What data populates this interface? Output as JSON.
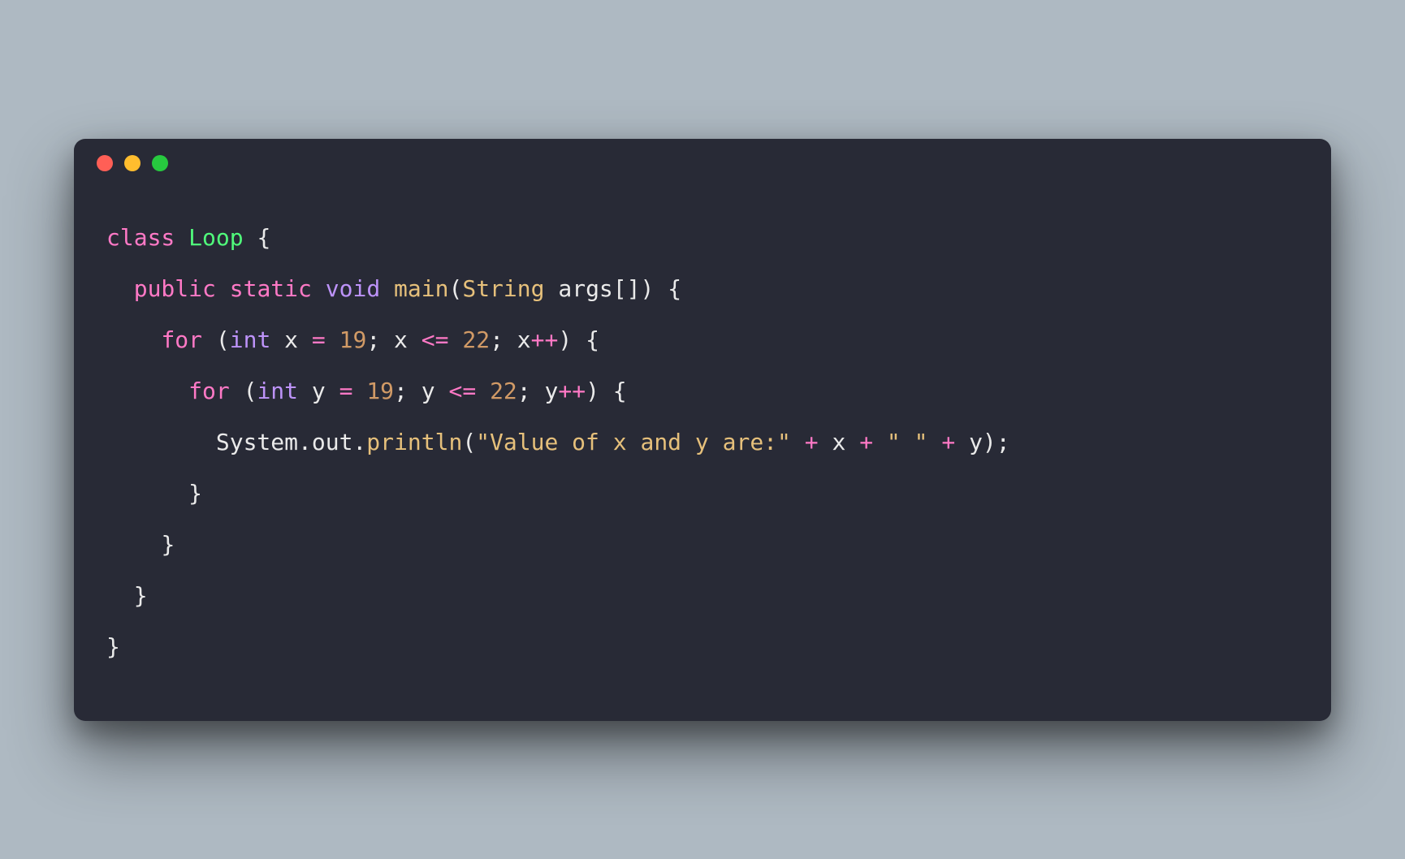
{
  "window": {
    "buttons": [
      "close",
      "minimize",
      "zoom"
    ]
  },
  "code": {
    "language": "java",
    "lines": [
      {
        "indent": 0,
        "tokens": [
          {
            "t": "class ",
            "c": "kw"
          },
          {
            "t": "Loop",
            "c": "class"
          },
          {
            "t": " {",
            "c": "plain"
          }
        ]
      },
      {
        "indent": 1,
        "tokens": [
          {
            "t": "public ",
            "c": "kw"
          },
          {
            "t": "static ",
            "c": "kw"
          },
          {
            "t": "void ",
            "c": "type"
          },
          {
            "t": "main",
            "c": "fn"
          },
          {
            "t": "(",
            "c": "plain"
          },
          {
            "t": "String",
            "c": "str"
          },
          {
            "t": " args[]) {",
            "c": "plain"
          }
        ]
      },
      {
        "indent": 2,
        "tokens": [
          {
            "t": "for ",
            "c": "kw"
          },
          {
            "t": "(",
            "c": "plain"
          },
          {
            "t": "int",
            "c": "type"
          },
          {
            "t": " x ",
            "c": "plain"
          },
          {
            "t": "=",
            "c": "op"
          },
          {
            "t": " ",
            "c": "plain"
          },
          {
            "t": "19",
            "c": "num"
          },
          {
            "t": "; x ",
            "c": "plain"
          },
          {
            "t": "<=",
            "c": "op"
          },
          {
            "t": " ",
            "c": "plain"
          },
          {
            "t": "22",
            "c": "num"
          },
          {
            "t": "; x",
            "c": "plain"
          },
          {
            "t": "++",
            "c": "op"
          },
          {
            "t": ") {",
            "c": "plain"
          }
        ]
      },
      {
        "indent": 3,
        "tokens": [
          {
            "t": "for ",
            "c": "kw"
          },
          {
            "t": "(",
            "c": "plain"
          },
          {
            "t": "int",
            "c": "type"
          },
          {
            "t": " y ",
            "c": "plain"
          },
          {
            "t": "=",
            "c": "op"
          },
          {
            "t": " ",
            "c": "plain"
          },
          {
            "t": "19",
            "c": "num"
          },
          {
            "t": "; y ",
            "c": "plain"
          },
          {
            "t": "<=",
            "c": "op"
          },
          {
            "t": " ",
            "c": "plain"
          },
          {
            "t": "22",
            "c": "num"
          },
          {
            "t": "; y",
            "c": "plain"
          },
          {
            "t": "++",
            "c": "op"
          },
          {
            "t": ") {",
            "c": "plain"
          }
        ]
      },
      {
        "indent": 4,
        "tokens": [
          {
            "t": "System.out.",
            "c": "plain"
          },
          {
            "t": "println",
            "c": "fn"
          },
          {
            "t": "(",
            "c": "plain"
          },
          {
            "t": "\"Value of x and y are:\"",
            "c": "lit"
          },
          {
            "t": " ",
            "c": "plain"
          },
          {
            "t": "+",
            "c": "op"
          },
          {
            "t": " x ",
            "c": "plain"
          },
          {
            "t": "+",
            "c": "op"
          },
          {
            "t": " ",
            "c": "plain"
          },
          {
            "t": "\" \"",
            "c": "lit"
          },
          {
            "t": " ",
            "c": "plain"
          },
          {
            "t": "+",
            "c": "op"
          },
          {
            "t": " y);",
            "c": "plain"
          }
        ]
      },
      {
        "indent": 3,
        "tokens": [
          {
            "t": "}",
            "c": "plain"
          }
        ]
      },
      {
        "indent": 2,
        "tokens": [
          {
            "t": "}",
            "c": "plain"
          }
        ]
      },
      {
        "indent": 1,
        "tokens": [
          {
            "t": "}",
            "c": "plain"
          }
        ]
      },
      {
        "indent": 0,
        "tokens": [
          {
            "t": "}",
            "c": "plain"
          }
        ]
      }
    ]
  }
}
